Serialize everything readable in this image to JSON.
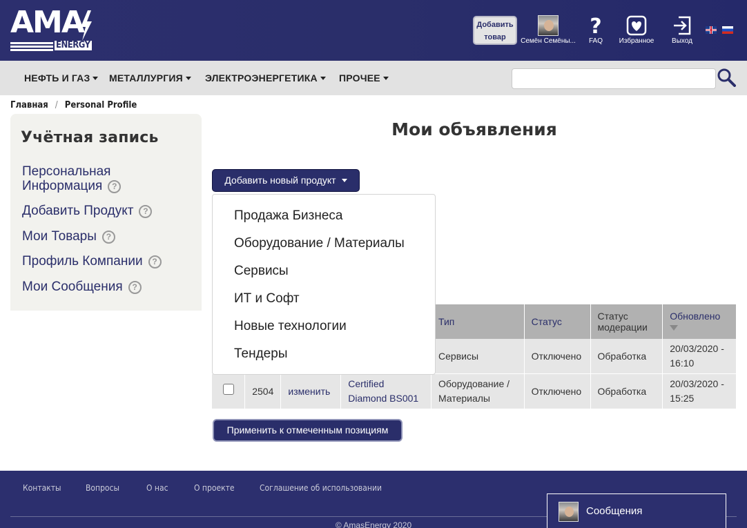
{
  "header": {
    "logo_text": "AMA",
    "logo_sub": "ENERGY",
    "add_goods": "Добавить товар",
    "user_name": "Семён Семёны...",
    "faq_label": "FAQ",
    "favorites_label": "Избранное",
    "exit_label": "Выход",
    "faq_icon": "question-icon",
    "favorites_icon": "heart-icon",
    "exit_icon": "exit-icon",
    "languages": [
      "en",
      "ru"
    ]
  },
  "nav": {
    "items": [
      "НЕФТЬ И ГАЗ",
      "МЕТАЛЛУРГИЯ",
      "ЭЛЕКТРОЭНЕРГЕТИКА",
      "ПРОЧЕЕ"
    ],
    "search_placeholder": ""
  },
  "breadcrumb": {
    "home": "Главная",
    "sep": "/",
    "current": "Personal Profile"
  },
  "sidebar": {
    "title": "Учётная запись",
    "items": [
      "Персональная Информация",
      "Добавить Продукт",
      "Мои Товары",
      "Профиль Компании",
      "Мои Сообщения"
    ],
    "help_icon": "?"
  },
  "main": {
    "title": "Мои объявления",
    "add_product": "Добавить новый продукт",
    "dropdown": [
      "Продажа Бизнеса",
      "Оборудование / Материалы",
      "Сервисы",
      "ИТ и Софт",
      "Новые технологии",
      "Тендеры"
    ],
    "table": {
      "headers": [
        "Тип",
        "Статус",
        "Статус модерации",
        "Обновлено"
      ],
      "rows": [
        {
          "id": "",
          "edit": "",
          "name": "",
          "type": "Сервисы",
          "status": "Отключено",
          "moderation": "Обработка",
          "updated": "20/03/2020 - 16:10"
        },
        {
          "id": "2504",
          "edit": "изменить",
          "name": "Certified Diamond BS001",
          "type": "Оборудование / Материалы",
          "status": "Отключено",
          "moderation": "Обработка",
          "updated": "20/03/2020 - 15:25"
        }
      ]
    },
    "apply": "Применить к отмеченным позициям"
  },
  "footer": {
    "links": [
      "Контакты",
      "Вопросы",
      "О нас",
      "О проекте",
      "Соглашение об использовании"
    ],
    "copyright": "© AmasEnergy 2020",
    "messages": "Сообщения"
  },
  "colors": {
    "brand": "#2a2e6a",
    "nav_bg": "#e2e2e2",
    "table_header": "#b1b1b1",
    "table_row": "#e6e6e6"
  }
}
